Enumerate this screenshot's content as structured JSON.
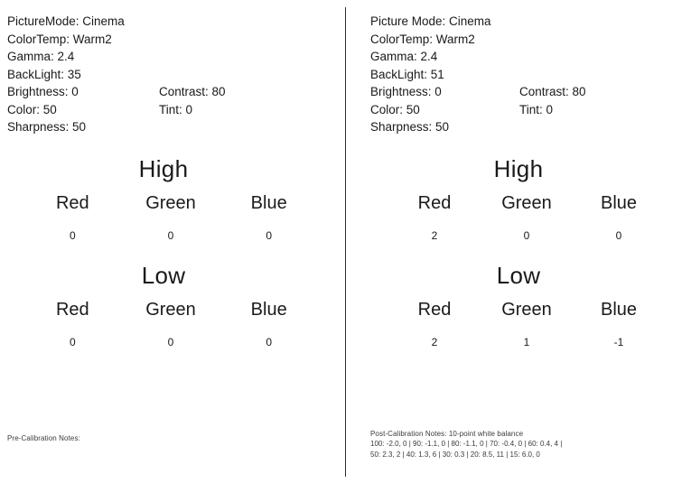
{
  "left_panel": {
    "settings": [
      {
        "label": "PictureMode: Cinema",
        "second": ""
      },
      {
        "label": "ColorTemp: Warm2",
        "second": ""
      },
      {
        "label": "Gamma: 2.4",
        "second": ""
      },
      {
        "label": "BackLight: 35",
        "second": ""
      },
      {
        "label": "Brightness: 0",
        "second": "Contrast: 80"
      },
      {
        "label": "Color: 50",
        "second": "Tint: 0"
      },
      {
        "label": "Sharpness: 50",
        "second": ""
      }
    ],
    "high": {
      "title": "High",
      "channels": [
        {
          "name": "Red",
          "value": "0"
        },
        {
          "name": "Green",
          "value": "0"
        },
        {
          "name": "Blue",
          "value": "0"
        }
      ]
    },
    "low": {
      "title": "Low",
      "channels": [
        {
          "name": "Red",
          "value": "0"
        },
        {
          "name": "Green",
          "value": "0"
        },
        {
          "name": "Blue",
          "value": "0"
        }
      ]
    },
    "notes": {
      "title": "Pre-Calibration Notes:",
      "lines": []
    }
  },
  "right_panel": {
    "settings": [
      {
        "label": "Picture Mode: Cinema",
        "second": ""
      },
      {
        "label": "ColorTemp: Warm2",
        "second": ""
      },
      {
        "label": "Gamma: 2.4",
        "second": ""
      },
      {
        "label": "BackLight: 51",
        "second": ""
      },
      {
        "label": "Brightness: 0",
        "second": "Contrast: 80"
      },
      {
        "label": "Color: 50",
        "second": "Tint: 0"
      },
      {
        "label": "Sharpness: 50",
        "second": ""
      }
    ],
    "high": {
      "title": "High",
      "channels": [
        {
          "name": "Red",
          "value": "2"
        },
        {
          "name": "Green",
          "value": "0"
        },
        {
          "name": "Blue",
          "value": "0"
        }
      ]
    },
    "low": {
      "title": "Low",
      "channels": [
        {
          "name": "Red",
          "value": "2"
        },
        {
          "name": "Green",
          "value": "1"
        },
        {
          "name": "Blue",
          "value": "-1"
        }
      ]
    },
    "notes": {
      "title": "Post-Calibration Notes: 10-point white balance",
      "lines": [
        "100: -2.0, 0 | 90: -1.1, 0 | 80: -1.1, 0 | 70: -0.4, 0 | 60: 0.4, 4 |",
        "50: 2.3, 2 | 40: 1.3, 6 | 30: 0.3 | 20: 8.5, 11 | 15: 6.0, 0"
      ]
    }
  }
}
